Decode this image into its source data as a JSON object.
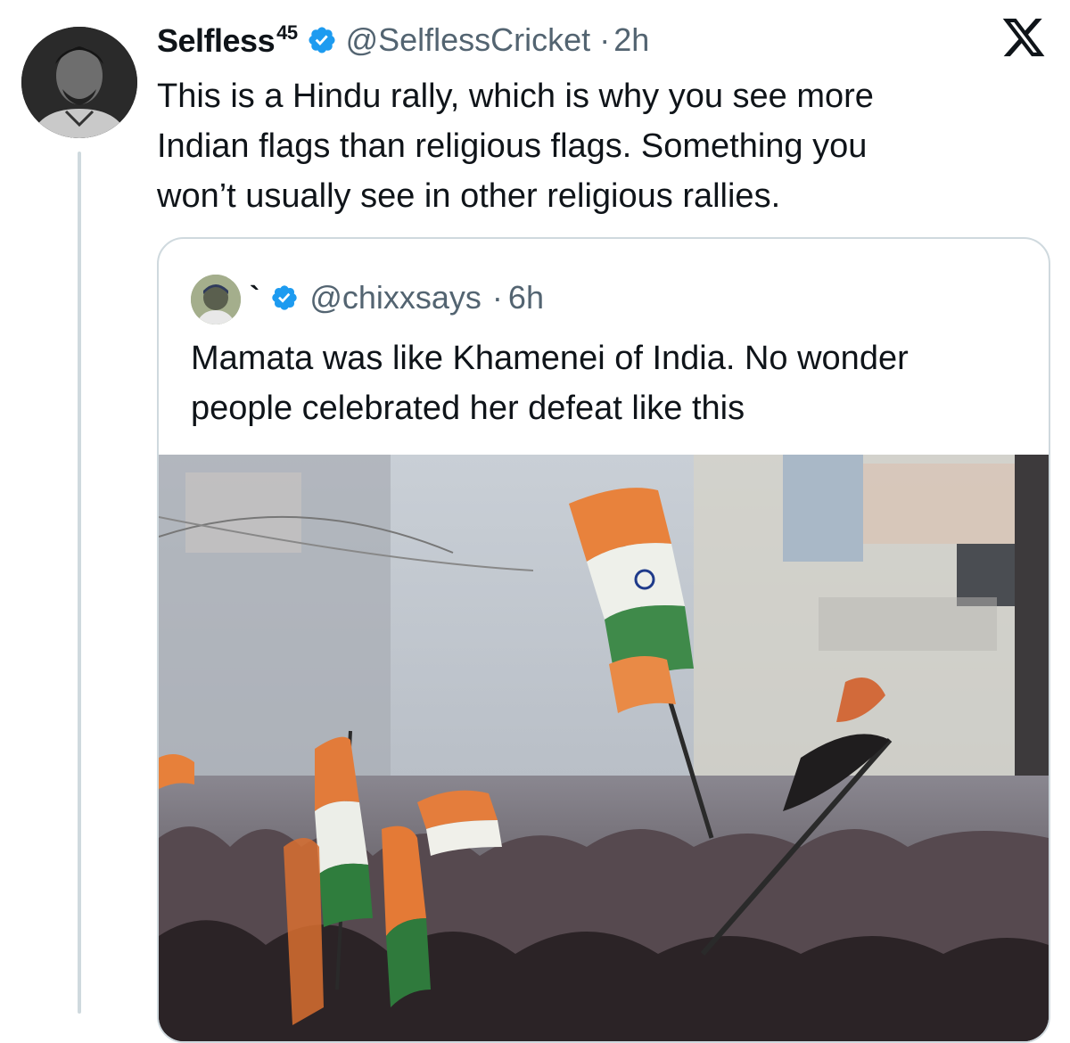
{
  "tweet": {
    "author_name": "Selfless",
    "author_superscript": "45",
    "handle": "@SelflessCricket",
    "separator": "·",
    "time": "2h",
    "text": "This is a Hindu rally, which is why you see more\nIndian flags than religious flags. Something you\nwon’t usually see in other religious rallies."
  },
  "quoted": {
    "author_name": "`",
    "handle": "@chixxsays",
    "separator": "·",
    "time": "6h",
    "text": "Mamata was like Khamenei of India. No wonder\npeople celebrated her defeat like this"
  },
  "icons": {
    "verified": "verified-badge-icon",
    "platform": "x-logo-icon"
  },
  "colors": {
    "verified_blue": "#1d9bf0",
    "text_primary": "#0f1419",
    "text_secondary": "#536471",
    "border": "#cfd9de"
  }
}
